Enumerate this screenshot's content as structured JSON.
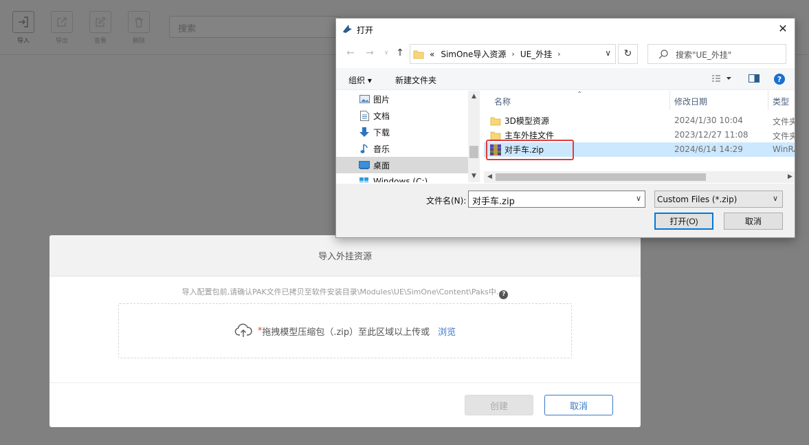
{
  "toolbar": {
    "items": [
      {
        "label": "导入",
        "icon": "import-icon"
      },
      {
        "label": "导出",
        "icon": "export-icon"
      },
      {
        "label": "查看",
        "icon": "view-icon"
      },
      {
        "label": "删除",
        "icon": "delete-icon"
      }
    ],
    "search_placeholder": "搜索"
  },
  "modal": {
    "title": "导入外挂资源",
    "hint": "导入配置包前,请确认PAK文件已拷贝至软件安装目录\\Modules\\UE\\SimOne\\Content\\Paks中.",
    "help": "?",
    "dropzone": {
      "required_mark": "*",
      "text": "拖拽模型压缩包（.zip）至此区域以上传或",
      "browse": "浏览"
    },
    "create_label": "创建",
    "cancel_label": "取消"
  },
  "file_dialog": {
    "title": "打开",
    "close": "✕",
    "breadcrumb": {
      "prefix": "«",
      "parts": [
        "SimOne导入资源",
        "UE_外挂"
      ],
      "sep": "›"
    },
    "search_placeholder": "搜索\"UE_外挂\"",
    "commands": {
      "organize": "组织 ▾",
      "new_folder": "新建文件夹"
    },
    "tree": [
      {
        "label": "图片",
        "icon": "pictures-icon",
        "selected": false
      },
      {
        "label": "文档",
        "icon": "documents-icon",
        "selected": false
      },
      {
        "label": "下载",
        "icon": "downloads-icon",
        "selected": false
      },
      {
        "label": "音乐",
        "icon": "music-icon",
        "selected": false
      },
      {
        "label": "桌面",
        "icon": "desktop-icon",
        "selected": true
      },
      {
        "label": "Windows (C:)",
        "icon": "drive-icon",
        "selected": false
      }
    ],
    "columns": {
      "name": "名称",
      "date": "修改日期",
      "type": "类型"
    },
    "files": [
      {
        "name": "3D模型资源",
        "date": "2024/1/30 10:04",
        "type": "文件夹",
        "icon": "folder-icon",
        "selected": false
      },
      {
        "name": "主车外挂文件",
        "date": "2023/12/27 11:08",
        "type": "文件夹",
        "icon": "folder-icon",
        "selected": false
      },
      {
        "name": "对手车.zip",
        "date": "2024/6/14 14:29",
        "type": "WinRAR",
        "icon": "winrar-archive-icon",
        "selected": true
      }
    ],
    "filename_label": "文件名(N):",
    "filename_value": "对手车.zip",
    "filetype_value": "Custom Files (*.zip)",
    "open_label": "打开(O)",
    "cancel_label": "取消"
  }
}
